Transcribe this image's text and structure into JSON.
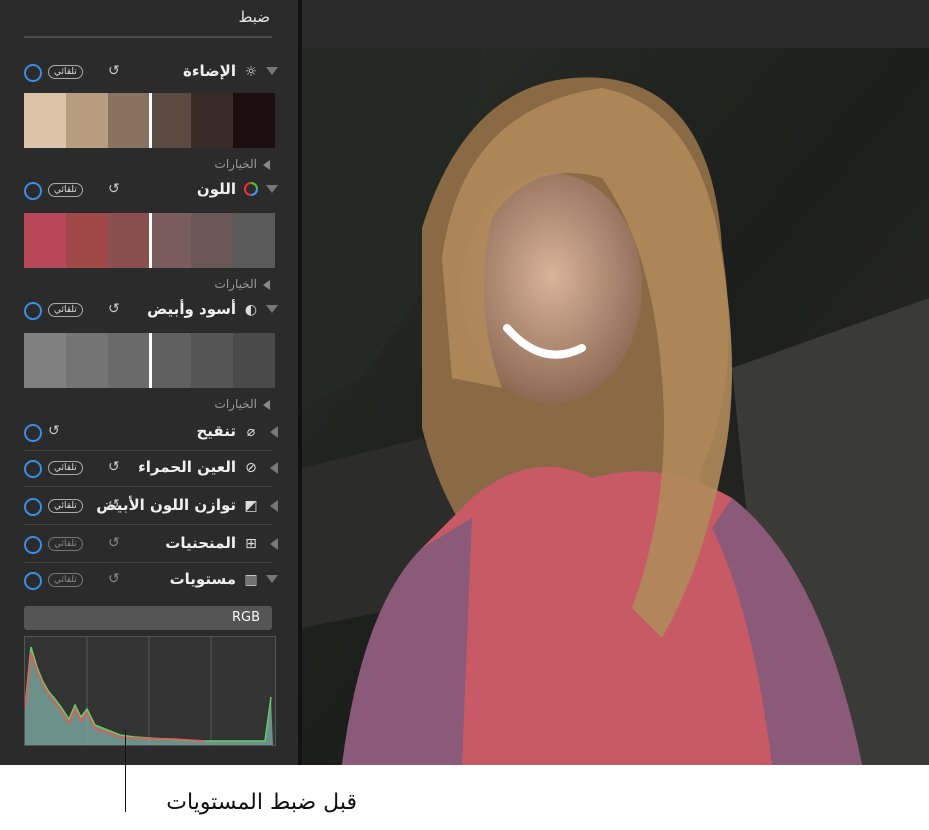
{
  "sidebar": {
    "title": "ضبط",
    "auto_label": "تلقائي",
    "options_label": "الخيارات",
    "sections": [
      {
        "label": "الإضاءة",
        "icon": "sun-icon"
      },
      {
        "label": "اللون",
        "icon": "color-wheel-icon"
      },
      {
        "label": "أسود وأبيض",
        "icon": "half-circle-icon"
      },
      {
        "label": "تنقيح",
        "icon": "bandage-icon"
      },
      {
        "label": "العين الحمراء",
        "icon": "eye-slash-icon"
      },
      {
        "label": "توازن اللون الأبيض",
        "icon": "white-balance-icon"
      },
      {
        "label": "المنحنيات",
        "icon": "curves-icon"
      },
      {
        "label": "مستويات",
        "icon": "levels-icon"
      }
    ],
    "channel_select": "RGB"
  },
  "caption": "قبل ضبط المستويات",
  "colors": {
    "accent": "#3a8ee6",
    "panel": "#2b2b2b"
  }
}
